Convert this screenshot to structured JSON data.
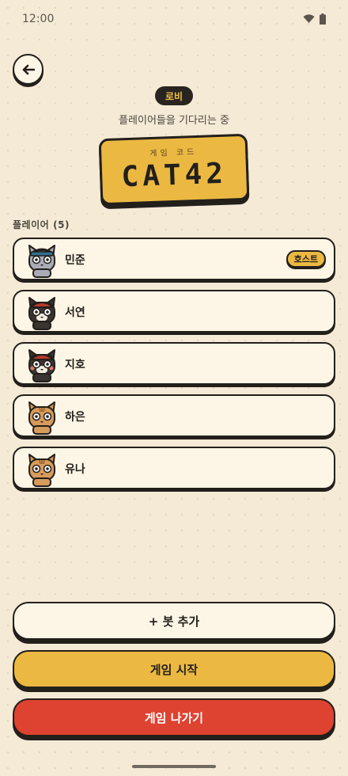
{
  "status": {
    "time": "12:00",
    "icons": [
      "wifi-icon",
      "battery-icon"
    ]
  },
  "header": {
    "back_icon": "arrow-left-icon",
    "lobby_label": "로비",
    "subtitle": "플레이어들을 기다리는 중",
    "code_label": "게임 코드",
    "code": "CAT42"
  },
  "players": {
    "title": "플레이어",
    "count": "(5)",
    "items": [
      {
        "name": "민준",
        "avatar": "cat-avatar-gray-blue-cap",
        "badge": "호스트"
      },
      {
        "name": "서연",
        "avatar": "cat-avatar-black-red-cap"
      },
      {
        "name": "지호",
        "avatar": "cat-avatar-black-red-cap"
      },
      {
        "name": "하은",
        "avatar": "cat-avatar-orange-tabby"
      },
      {
        "name": "유나",
        "avatar": "cat-avatar-orange-tabby"
      }
    ]
  },
  "actions": {
    "add_bot": "+ 봇 추가",
    "start": "게임 시작",
    "leave": "게임 나가기"
  },
  "colors": {
    "background": "#f5ead6",
    "card": "#fdf6e6",
    "accent_yellow": "#ebb942",
    "danger_red": "#de4231",
    "outline": "#231f1b"
  }
}
